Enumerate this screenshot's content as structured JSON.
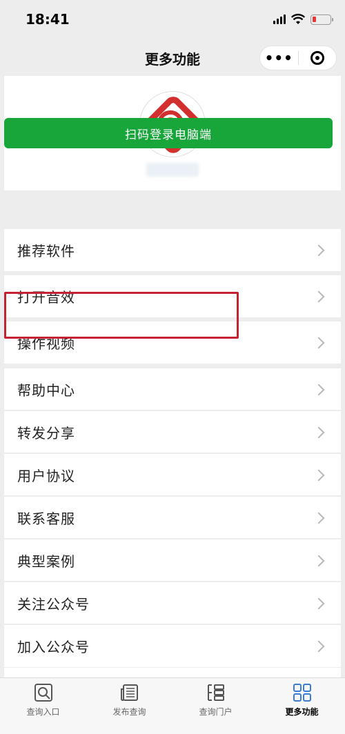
{
  "status_bar": {
    "time": "18:41",
    "battery_color": "#e53935"
  },
  "navbar": {
    "title": "更多功能",
    "menu_glyph": "•••"
  },
  "profile": {
    "logo_colors": {
      "primary": "#d32f2f",
      "accent": "#e58a2c"
    }
  },
  "scan_button": {
    "label": "扫码登录电脑端",
    "color": "#18a63a"
  },
  "menu": {
    "items": [
      {
        "label": "推荐软件"
      },
      {
        "label": "打开音效"
      },
      {
        "label": "操作视频"
      },
      {
        "label": "帮助中心"
      },
      {
        "label": "转发分享"
      },
      {
        "label": "用户协议"
      },
      {
        "label": "联系客服"
      },
      {
        "label": "典型案例"
      },
      {
        "label": "关注公众号"
      },
      {
        "label": "加入公众号"
      }
    ]
  },
  "tabbar": {
    "tabs": [
      {
        "label": "查询入口",
        "icon": "search-box-icon",
        "active": false
      },
      {
        "label": "发布查询",
        "icon": "newspaper-icon",
        "active": false
      },
      {
        "label": "查询门户",
        "icon": "portal-icon",
        "active": false
      },
      {
        "label": "更多功能",
        "icon": "grid-icon",
        "active": true
      }
    ],
    "active_color": "#3a7bd5"
  }
}
